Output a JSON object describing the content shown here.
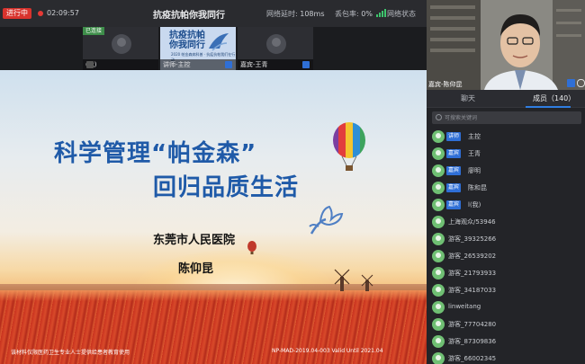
{
  "topbar": {
    "live_badge": "进行中",
    "timer": "02:09:57",
    "title": "抗疫抗帕你我同行",
    "latency_label": "网络延时: ",
    "latency_value": "108ms",
    "loss_label": "丢包率: ",
    "loss_value": "0%",
    "net_status": "网络状态",
    "net_status_color": "#3ec46d",
    "live_color": "#d8332d"
  },
  "strip": {
    "tile1": {
      "tag": "已连接",
      "caption": "(我)"
    },
    "tile2": {
      "poster_title_1": "抗疫抗帕",
      "poster_title_2": "你我同行",
      "poster_sub": "2020 帕金森病科普 · 抗疫抗帕我们在行动",
      "caption": "讲师-主控"
    },
    "tile3": {
      "caption": "嘉宾-王青"
    }
  },
  "slide": {
    "title_line1": "科学管理“帕金森”",
    "title_line2": "回归品质生活",
    "hospital": "东莞市人民医院",
    "doctor": "陈仰昆",
    "footer_left": "该材料仅限医药卫生专业人士提供给患者教育使用",
    "footer_right": "NP-MAD-2019.04-003 Valid Until 2021.04",
    "title_color": "#1f5aa8"
  },
  "camera": {
    "caption": "嘉宾-陈仰昆"
  },
  "panel": {
    "tab_chat": "聊天",
    "tab_members": "成员（140）",
    "search_placeholder": "可搜索关键词",
    "members": [
      {
        "tag": "讲师",
        "name": "主控"
      },
      {
        "tag": "嘉宾",
        "name": "王青"
      },
      {
        "tag": "嘉宾",
        "name": "廖明"
      },
      {
        "tag": "嘉宾",
        "name": "陈和昆"
      },
      {
        "tag": "嘉宾",
        "name": "l(我)"
      },
      {
        "tag": "",
        "name": "上海观众/53946"
      },
      {
        "tag": "",
        "name": "游客_39325266"
      },
      {
        "tag": "",
        "name": "游客_26539202"
      },
      {
        "tag": "",
        "name": "游客_21793933"
      },
      {
        "tag": "",
        "name": "游客_34187033"
      },
      {
        "tag": "",
        "name": "linweitang"
      },
      {
        "tag": "",
        "name": "游客_77704280"
      },
      {
        "tag": "",
        "name": "游客_87309836"
      },
      {
        "tag": "",
        "name": "游客_66002345"
      }
    ],
    "accent_color": "#2f7de1"
  }
}
